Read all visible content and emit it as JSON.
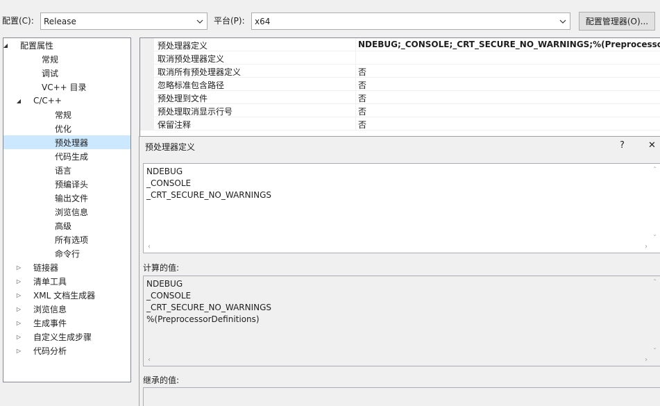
{
  "config_bar": {
    "config_label": "配置(C):",
    "config_value": "Release",
    "platform_label": "平台(P):",
    "platform_value": "x64",
    "manager_button": "配置管理器(O)..."
  },
  "tree": {
    "items": [
      {
        "label": "配置属性",
        "toggle": "◢"
      },
      {
        "label": "常规"
      },
      {
        "label": "调试"
      },
      {
        "label": "VC++ 目录"
      },
      {
        "label": "C/C++",
        "toggle": "◢"
      },
      {
        "label": "常规"
      },
      {
        "label": "优化"
      },
      {
        "label": "预处理器",
        "selected": true
      },
      {
        "label": "代码生成"
      },
      {
        "label": "语言"
      },
      {
        "label": "预编译头"
      },
      {
        "label": "输出文件"
      },
      {
        "label": "浏览信息"
      },
      {
        "label": "高级"
      },
      {
        "label": "所有选项"
      },
      {
        "label": "命令行"
      },
      {
        "label": "链接器",
        "toggle": "▷"
      },
      {
        "label": "清单工具",
        "toggle": "▷"
      },
      {
        "label": "XML 文档生成器",
        "toggle": "▷"
      },
      {
        "label": "浏览信息",
        "toggle": "▷"
      },
      {
        "label": "生成事件",
        "toggle": "▷"
      },
      {
        "label": "自定义生成步骤",
        "toggle": "▷"
      },
      {
        "label": "代码分析",
        "toggle": "▷"
      }
    ]
  },
  "properties": {
    "rows": [
      {
        "name": "预处理器定义",
        "value": "NDEBUG;_CONSOLE;_CRT_SECURE_NO_WARNINGS;%(PreprocessorDefi"
      },
      {
        "name": "取消预处理器定义",
        "value": ""
      },
      {
        "name": "取消所有预处理器定义",
        "value": "否"
      },
      {
        "name": "忽略标准包含路径",
        "value": "否"
      },
      {
        "name": "预处理到文件",
        "value": "否"
      },
      {
        "name": "预处理取消显示行号",
        "value": "否"
      },
      {
        "name": "保留注释",
        "value": "否"
      }
    ]
  },
  "dialog": {
    "title": "预处理器定义",
    "help_glyph": "?",
    "close_glyph": "✕",
    "edit_text": "NDEBUG\n_CONSOLE\n_CRT_SECURE_NO_WARNINGS",
    "computed_label": "计算的值:",
    "computed_text": "NDEBUG\n_CONSOLE\n_CRT_SECURE_NO_WARNINGS\n%(PreprocessorDefinitions)",
    "inherited_label": "继承的值:"
  },
  "icons": {
    "dropdown": "chevron-down-icon",
    "expanded": "expanded-triangle-icon",
    "collapsed": "collapsed-triangle-icon",
    "scroll_left": "‹",
    "scroll_right": "›",
    "scroll_up": "ˆ",
    "scroll_down": "ˇ"
  },
  "colors": {
    "selection": "#cce8ff",
    "window_bg": "#f0f0f0",
    "border": "#adadad"
  }
}
